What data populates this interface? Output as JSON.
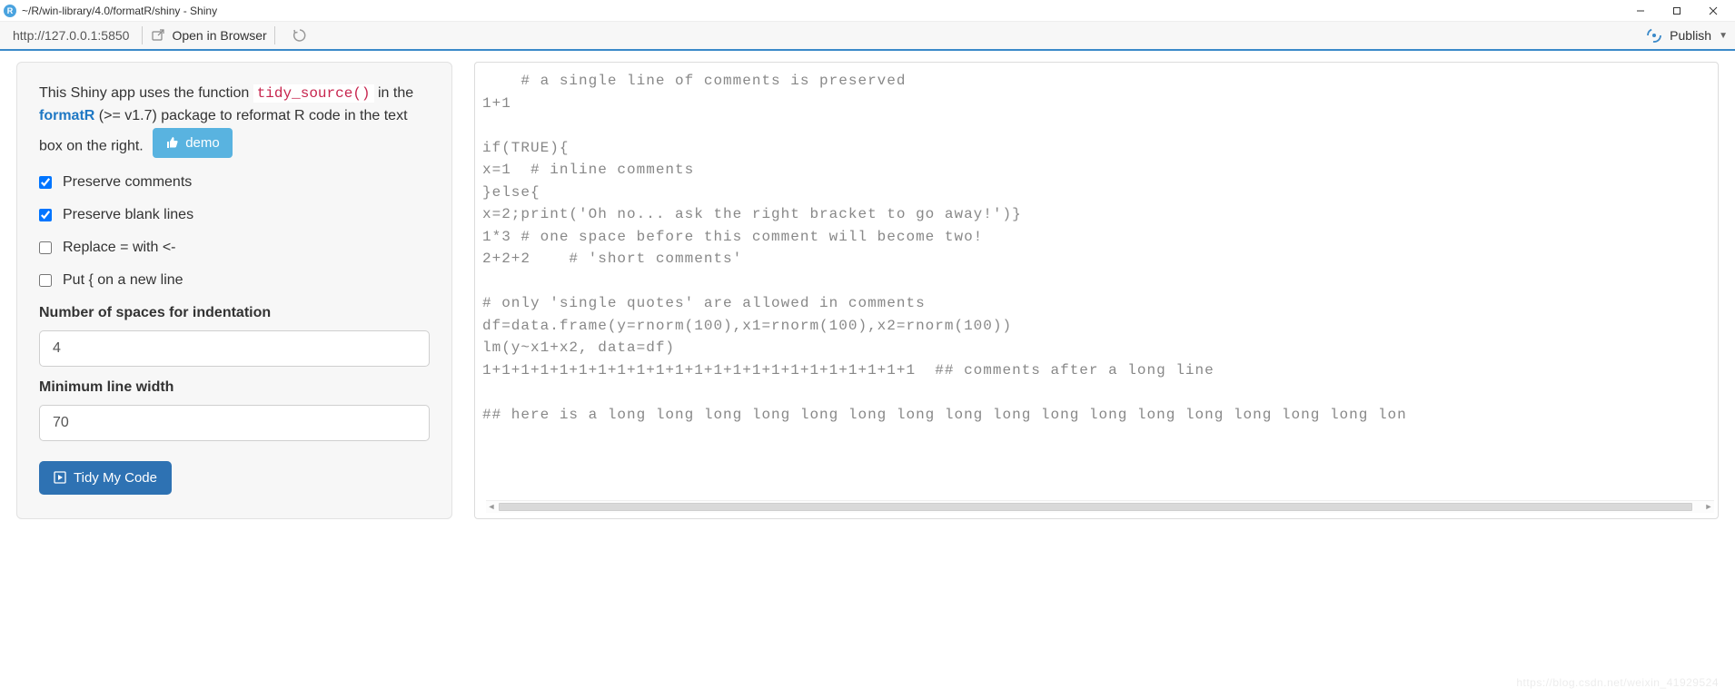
{
  "window": {
    "title": "~/R/win-library/4.0/formatR/shiny - Shiny",
    "app_icon_letter": "R"
  },
  "toolbar": {
    "url": "http://127.0.0.1:5850",
    "open_browser": "Open in Browser",
    "publish": "Publish"
  },
  "intro": {
    "part1": "This Shiny app uses the function ",
    "code_fn": "tidy_source()",
    "part2": " in the ",
    "link_text": "formatR",
    "part3": " (>= v1.7) package to reformat R code in the text box on the right. ",
    "demo_label": "demo"
  },
  "checks": {
    "preserve_comments": {
      "label": "Preserve comments",
      "checked": true
    },
    "preserve_blank_lines": {
      "label": "Preserve blank lines",
      "checked": true
    },
    "replace_equals": {
      "label": "Replace = with <-",
      "checked": false
    },
    "brace_newline": {
      "label": "Put { on a new line",
      "checked": false
    }
  },
  "inputs": {
    "indent": {
      "label": "Number of spaces for indentation",
      "value": "4"
    },
    "width": {
      "label": "Minimum line width",
      "value": "70"
    }
  },
  "actions": {
    "tidy_label": "Tidy My Code"
  },
  "code": "    # a single line of comments is preserved\n1+1\n\nif(TRUE){\nx=1  # inline comments\n}else{\nx=2;print('Oh no... ask the right bracket to go away!')}\n1*3 # one space before this comment will become two!\n2+2+2    # 'short comments'\n\n# only 'single quotes' are allowed in comments\ndf=data.frame(y=rnorm(100),x1=rnorm(100),x2=rnorm(100))\nlm(y~x1+x2, data=df)\n1+1+1+1+1+1+1+1+1+1+1+1+1+1+1+1+1+1+1+1+1+1+1  ## comments after a long line\n\n## here is a long long long long long long long long long long long long long long long long lon",
  "watermark": "https://blog.csdn.net/weixin_41929524"
}
